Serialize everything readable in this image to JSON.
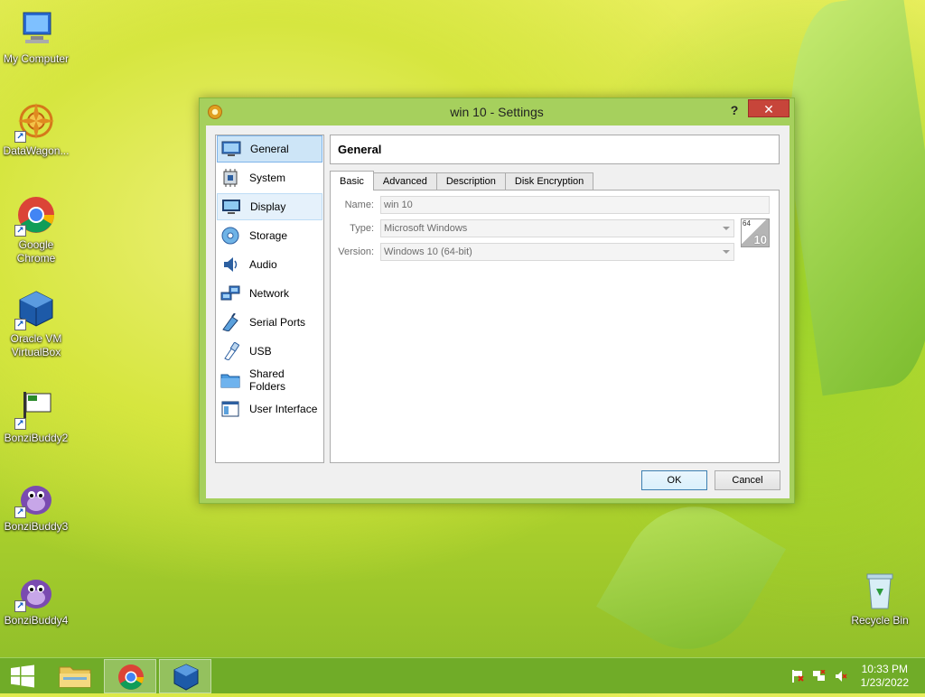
{
  "desktop": {
    "icons": [
      {
        "label": "My Computer"
      },
      {
        "label": "DataWagon..."
      },
      {
        "label": "Google Chrome"
      },
      {
        "label": "Oracle VM VirtualBox"
      },
      {
        "label": "BonziBuddy2"
      },
      {
        "label": "BonziBuddy3"
      },
      {
        "label": "BonziBuddy4"
      },
      {
        "label": "Recycle Bin"
      }
    ]
  },
  "window": {
    "title": "win 10 - Settings",
    "help_label": "?",
    "close_label": "✕"
  },
  "nav": {
    "items": [
      {
        "label": "General",
        "icon": "general-icon"
      },
      {
        "label": "System",
        "icon": "system-icon"
      },
      {
        "label": "Display",
        "icon": "display-icon"
      },
      {
        "label": "Storage",
        "icon": "storage-icon"
      },
      {
        "label": "Audio",
        "icon": "audio-icon"
      },
      {
        "label": "Network",
        "icon": "network-icon"
      },
      {
        "label": "Serial Ports",
        "icon": "serial-ports-icon"
      },
      {
        "label": "USB",
        "icon": "usb-icon"
      },
      {
        "label": "Shared Folders",
        "icon": "shared-folders-icon"
      },
      {
        "label": "User Interface",
        "icon": "user-interface-icon"
      }
    ],
    "selected": "General",
    "hovered": "Display"
  },
  "page": {
    "header": "General",
    "tabs": [
      {
        "label": "Basic"
      },
      {
        "label": "Advanced"
      },
      {
        "label": "Description"
      },
      {
        "label": "Disk Encryption"
      }
    ],
    "active_tab": "Basic",
    "fields": {
      "name_label": "Name:",
      "name_value": "win 10",
      "type_label": "Type:",
      "type_value": "Microsoft Windows",
      "version_label": "Version:",
      "version_value": "Windows 10 (64-bit)"
    },
    "os_badge": {
      "top": "64",
      "bottom": "10"
    }
  },
  "buttons": {
    "ok": "OK",
    "cancel": "Cancel"
  },
  "taskbar": {
    "time": "10:33 PM",
    "date": "1/23/2022"
  },
  "colors": {
    "accent_selection": "#cde5f7",
    "close_button": "#c7453a",
    "window_frame": "#a6d05d"
  }
}
